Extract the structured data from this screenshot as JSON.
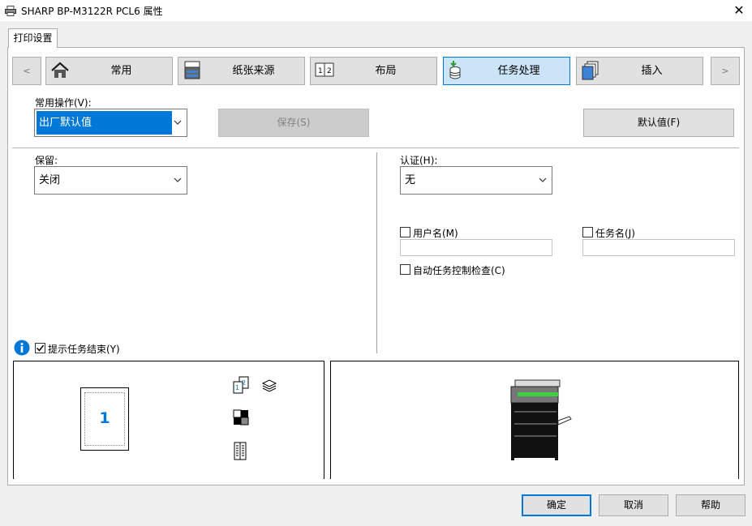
{
  "window": {
    "title": "SHARP BP-M3122R PCL6 属性",
    "close_glyph": "✕"
  },
  "tab": {
    "label": "打印设置"
  },
  "categories": {
    "prev_glyph": "<",
    "next_glyph": ">",
    "items": [
      {
        "label": "常用",
        "icon": "home-icon"
      },
      {
        "label": "纸张来源",
        "icon": "paper-source-icon"
      },
      {
        "label": "布局",
        "icon": "layout-icon"
      },
      {
        "label": "任务处理",
        "icon": "job-handling-icon",
        "active": true
      },
      {
        "label": "插入",
        "icon": "insert-icon"
      }
    ]
  },
  "favorites": {
    "label": "常用操作(V):",
    "value": "出厂默认值",
    "save_label": "保存(S)",
    "default_label": "默认值(F)"
  },
  "retention": {
    "label": "保留:",
    "value": "关闭"
  },
  "authentication": {
    "label": "认证(H):",
    "value": "无",
    "username_label": "用户名(M)",
    "username_value": "",
    "jobname_label": "任务名(J)",
    "jobname_value": "",
    "auto_job_control_label": "自动任务控制检查(C)"
  },
  "notify": {
    "label": "提示任务结束(Y)",
    "checked": true
  },
  "preview": {
    "page_number": "1"
  },
  "footer": {
    "ok": "确定",
    "cancel": "取消",
    "help": "帮助"
  },
  "colors": {
    "accent": "#0078d7",
    "selection": "#0078d7",
    "active_tab_bg": "#cce4f7",
    "info_icon": "#0078d7"
  }
}
